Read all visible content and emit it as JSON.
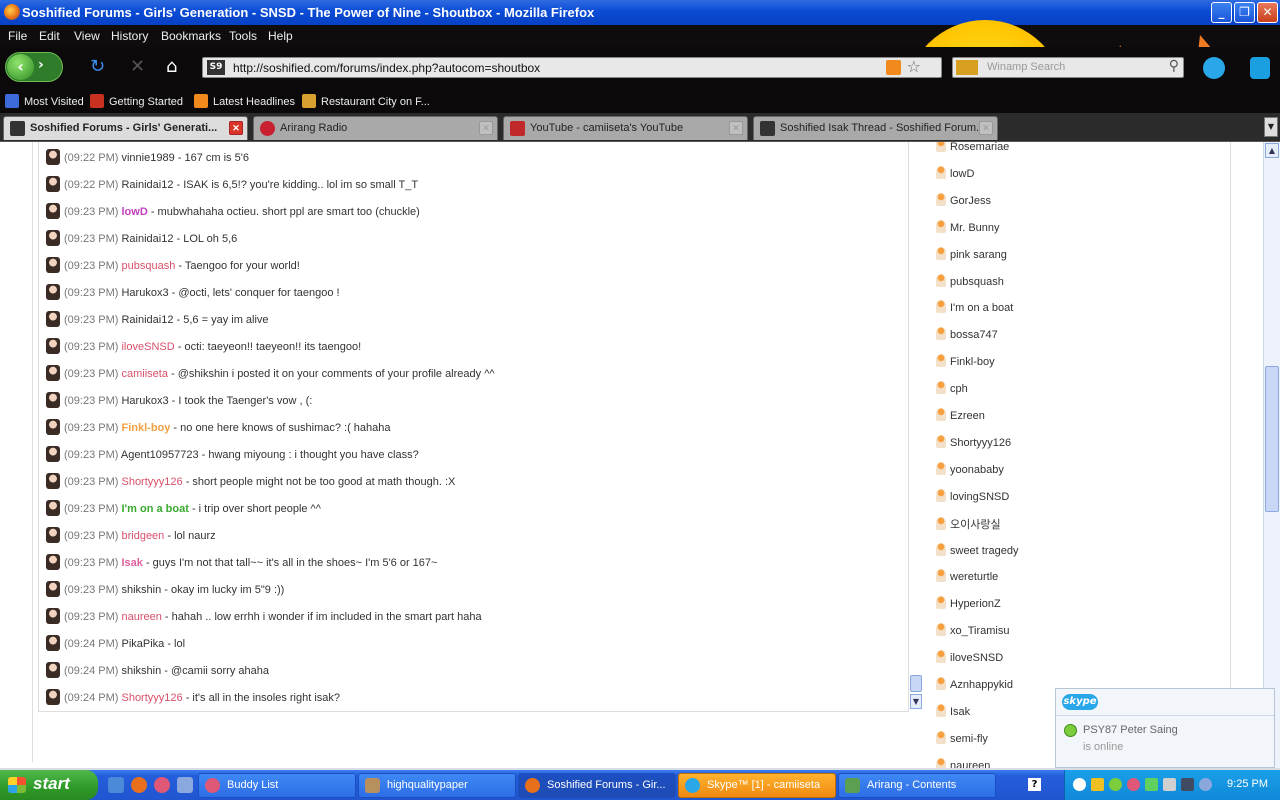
{
  "window": {
    "title": "Soshified Forums - Girls' Generation - SNSD - The Power of Nine - Shoutbox - Mozilla Firefox"
  },
  "menu": [
    "File",
    "Edit",
    "View",
    "History",
    "Bookmarks",
    "Tools",
    "Help"
  ],
  "address": {
    "url": "http://soshified.com/forums/index.php?autocom=shoutbox",
    "search_placeholder": "Winamp Search"
  },
  "bookmarks": [
    "Most Visited",
    "Getting Started",
    "Latest Headlines",
    "Restaurant City on F..."
  ],
  "tabs": [
    {
      "label": "Soshified Forums - Girls' Generati...",
      "active": true
    },
    {
      "label": "Arirang Radio",
      "active": false
    },
    {
      "label": "YouTube - camiiseta's YouTube",
      "active": false
    },
    {
      "label": "Soshified Isak Thread - Soshified Forum...",
      "active": false
    }
  ],
  "chat": {
    "messages": [
      {
        "time": "(09:22 PM)",
        "user": "vinnie1989",
        "text": " - 167 cm is 5'6",
        "color": "#333333",
        "bold": false
      },
      {
        "time": "(09:22 PM)",
        "user": "Rainidai12",
        "text": " - ISAK is 6,5!? you're kidding.. lol im so small T_T",
        "color": "#333333",
        "bold": false
      },
      {
        "time": "(09:23 PM)",
        "user": "lowD",
        "text": " - mubwhahaha octieu. short ppl are smart too (chuckle)",
        "color": "#c040c0",
        "bold": true
      },
      {
        "time": "(09:23 PM)",
        "user": "Rainidai12",
        "text": " - LOL oh 5,6",
        "color": "#333333",
        "bold": false
      },
      {
        "time": "(09:23 PM)",
        "user": "pubsquash",
        "text": " - Taengoo for your world!",
        "color": "#d8506a",
        "bold": false
      },
      {
        "time": "(09:23 PM)",
        "user": "Harukox3",
        "text": " - @octi, lets' conquer for taengoo !",
        "color": "#333333",
        "bold": false
      },
      {
        "time": "(09:23 PM)",
        "user": "Rainidai12",
        "text": " - 5,6 = yay im alive",
        "color": "#333333",
        "bold": false
      },
      {
        "time": "(09:23 PM)",
        "user": "iloveSNSD",
        "text": " - octi: taeyeon!! taeyeon!! its taengoo!",
        "color": "#d8506a",
        "bold": false
      },
      {
        "time": "(09:23 PM)",
        "user": "camiiseta",
        "text": " - @shikshin i posted it on your comments of your profile already ^^",
        "color": "#d8506a",
        "bold": false
      },
      {
        "time": "(09:23 PM)",
        "user": "Harukox3",
        "text": " - I took the Taenger's vow , (:",
        "color": "#333333",
        "bold": false
      },
      {
        "time": "(09:23 PM)",
        "user": "Finkl-boy",
        "text": " - no one here knows of sushimac? :( hahaha",
        "color": "#f0a040",
        "bold": true
      },
      {
        "time": "(09:23 PM)",
        "user": "Agent10957723",
        "text": " - hwang miyoung : i thought you have class?",
        "color": "#333333",
        "bold": false
      },
      {
        "time": "(09:23 PM)",
        "user": "Shortyyy126",
        "text": " - short people might not be too good at math though. :X",
        "color": "#d8506a",
        "bold": false
      },
      {
        "time": "(09:23 PM)",
        "user": "I'm on a boat",
        "text": " - i trip over short people ^^",
        "color": "#3aaa30",
        "bold": true
      },
      {
        "time": "(09:23 PM)",
        "user": "bridgeen",
        "text": " - lol naurz",
        "color": "#d8506a",
        "bold": false
      },
      {
        "time": "(09:23 PM)",
        "user": "Isak",
        "text": " - guys I'm not that tall~~ it's all in the shoes~ I'm 5'6 or 167~",
        "color": "#e060a0",
        "bold": true
      },
      {
        "time": "(09:23 PM)",
        "user": "shikshin",
        "text": " - okay im lucky im 5\"9 :))",
        "color": "#333333",
        "bold": false
      },
      {
        "time": "(09:23 PM)",
        "user": "naureen",
        "text": " - hahah .. low errhh i wonder if im included in the smart part haha",
        "color": "#d8506a",
        "bold": false
      },
      {
        "time": "(09:24 PM)",
        "user": "PikaPika",
        "text": " - lol",
        "color": "#333333",
        "bold": false
      },
      {
        "time": "(09:24 PM)",
        "user": "shikshin",
        "text": " - @camii sorry ahaha",
        "color": "#333333",
        "bold": false
      },
      {
        "time": "(09:24 PM)",
        "user": "Shortyyy126",
        "text": " - it's all in the insoles right isak?",
        "color": "#d8506a",
        "bold": false
      }
    ]
  },
  "online_users": [
    "Rosemariae",
    "lowD",
    "GorJess",
    "Mr. Bunny",
    "pink sarang",
    "pubsquash",
    "I'm on a boat",
    "bossa747",
    "Finkl-boy",
    "cph",
    "Ezreen",
    "Shortyyy126",
    "yoonababy",
    "lovingSNSD",
    "오이사랑실",
    "sweet tragedy",
    "wereturtle",
    "HyperionZ",
    "xo_Tiramisu",
    "iloveSNSD",
    "Aznhappykid",
    "Isak",
    "semi-fly",
    "naureen"
  ],
  "skype_popup": {
    "logo": "skype",
    "name": "PSY87 Peter Saing",
    "status": "is online"
  },
  "taskbar": {
    "start": "start",
    "buttons": [
      {
        "label": "Buddy List",
        "state": "normal"
      },
      {
        "label": "highqualitypaper",
        "state": "normal"
      },
      {
        "label": "Soshified Forums - Gir...",
        "state": "active"
      },
      {
        "label": "Skype™ [1] - camiiseta",
        "state": "alert"
      },
      {
        "label": "Arirang - Contents",
        "state": "normal"
      }
    ],
    "clock": "9:25 PM"
  }
}
